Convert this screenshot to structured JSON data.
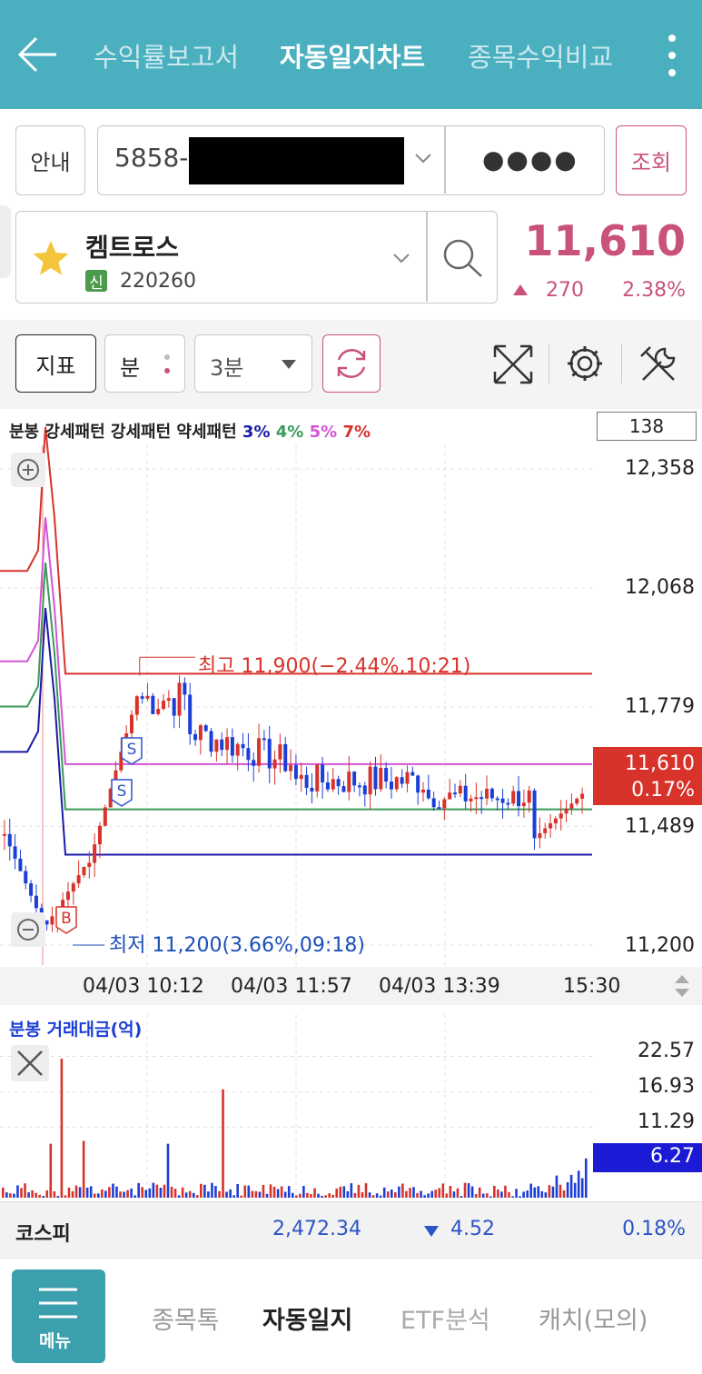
{
  "header": {
    "tabs": [
      "수익률보고서",
      "자동일지차트",
      "종목수익비교"
    ],
    "active_tab": 1
  },
  "account_bar": {
    "guide_label": "안내",
    "account_number": "5858-",
    "password_mask": "●●●●",
    "query_label": "조회"
  },
  "stock": {
    "name": "켐트로스",
    "badge": "신",
    "code": "220260",
    "price": "11,610",
    "change": "270",
    "change_pct": "2.38%"
  },
  "toolbar": {
    "indicator_label": "지표",
    "period_label": "분",
    "interval_label": "3분"
  },
  "chart": {
    "count_box": "138",
    "legend_prefix": "분봉 강세패턴 강세패턴 약세패턴",
    "legend_levels": [
      "3%",
      "4%",
      "5%",
      "7%"
    ],
    "price_axis": [
      "12,358",
      "12,068",
      "11,779",
      "11,489",
      "11,200"
    ],
    "current_price_tag": "11,610",
    "current_pct_tag": "0.17%",
    "high_note": "최고 11,900(−2.44%,10:21)",
    "low_note": "최저 11,200(3.66%,09:18)",
    "time_axis": [
      "04/03 10:12",
      "04/03 11:57",
      "04/03 13:39",
      "15:30"
    ],
    "volume_title": "분봉 거래대금(억)",
    "volume_axis": [
      "22.57",
      "16.93",
      "11.29"
    ],
    "volume_tag": "6.27",
    "marker_sell": "S",
    "marker_buy": "B"
  },
  "chart_data": {
    "type": "candlestick",
    "title": "분봉 강세패턴 강세패턴 약세패턴",
    "x": [
      "04/03 10:12",
      "04/03 11:57",
      "04/03 13:39",
      "15:30"
    ],
    "price_axis": [
      12358,
      12068,
      11779,
      11489,
      11200
    ],
    "high": 11900,
    "low": 11200,
    "last": 11610,
    "pattern_levels": [
      {
        "name": "3%",
        "color": "#1a1aa8",
        "value": 11420
      },
      {
        "name": "4%",
        "color": "#3a9a5a",
        "value": 11530
      },
      {
        "name": "5%",
        "color": "#d455d4",
        "value": 11640
      },
      {
        "name": "7%",
        "color": "#d8332b",
        "value": 11860
      }
    ],
    "volume_axis": [
      22.57,
      16.93,
      11.29
    ],
    "volume_last": 6.27
  },
  "index_bar": {
    "name": "코스피",
    "value": "2,472.34",
    "change": "4.52",
    "pct": "0.18%"
  },
  "bottom_nav": {
    "menu_label": "메뉴",
    "items": [
      "종목톡",
      "자동일지",
      "ETF분석",
      "캐치(모의)"
    ],
    "active": 1
  },
  "colors": {
    "header": "#4ab0bf",
    "up": "#d8332b",
    "down": "#1b3fd6",
    "accent": "#c9527a"
  }
}
